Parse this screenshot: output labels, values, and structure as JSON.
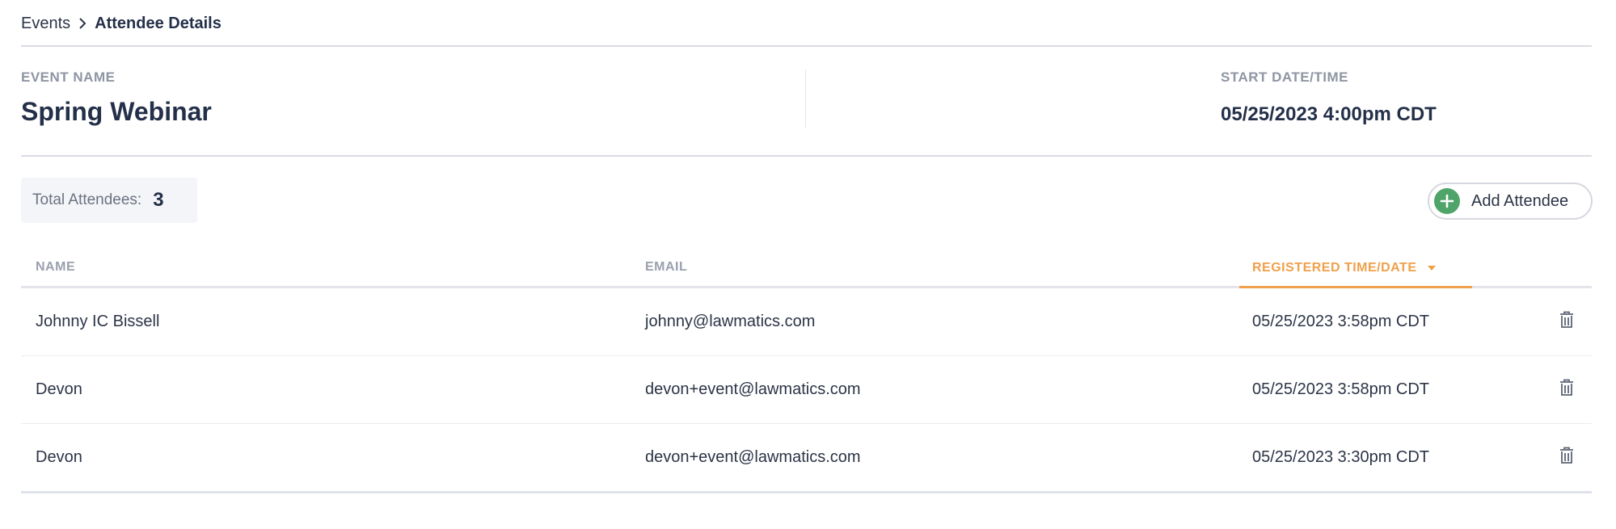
{
  "breadcrumb": {
    "parent": "Events",
    "current": "Attendee Details"
  },
  "event": {
    "name_label": "EVENT NAME",
    "name": "Spring Webinar",
    "start_label": "START DATE/TIME",
    "start": "05/25/2023 4:00pm CDT"
  },
  "summary": {
    "total_label": "Total Attendees:",
    "total_count": "3"
  },
  "actions": {
    "add_attendee": "Add Attendee"
  },
  "table": {
    "columns": {
      "name": "NAME",
      "email": "EMAIL",
      "registered": "REGISTERED TIME/DATE"
    },
    "rows": [
      {
        "name": "Johnny IC Bissell",
        "email": "johnny@lawmatics.com",
        "registered": "05/25/2023 3:58pm CDT"
      },
      {
        "name": "Devon",
        "email": "devon+event@lawmatics.com",
        "registered": "05/25/2023 3:58pm CDT"
      },
      {
        "name": "Devon",
        "email": "devon+event@lawmatics.com",
        "registered": "05/25/2023 3:30pm CDT"
      }
    ]
  },
  "colors": {
    "accent_sort": "#f0a04b",
    "add_green": "#4fa46a",
    "text_dark": "#243049"
  },
  "icons": {
    "breadcrumb_separator": "chevron-right-icon",
    "add": "plus-circle-icon",
    "sort": "caret-down-icon",
    "delete": "trash-icon"
  }
}
